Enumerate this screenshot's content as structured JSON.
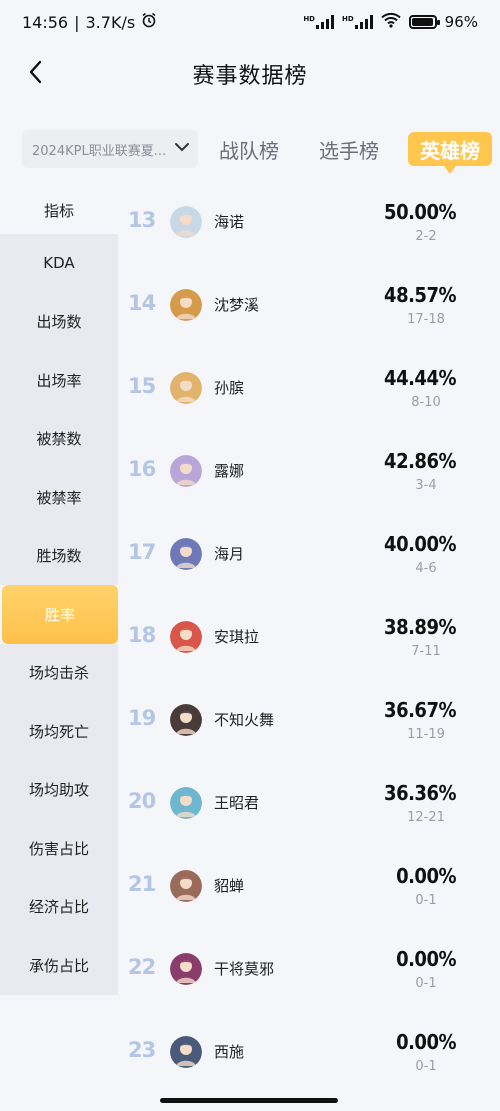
{
  "status_bar": {
    "time": "14:56",
    "speed": "3.7K/s",
    "battery": "96%"
  },
  "header": {
    "title": "赛事数据榜"
  },
  "tabs": {
    "season": "2024KPL职业联赛夏...",
    "team": "战队榜",
    "player": "选手榜",
    "hero": "英雄榜",
    "active": "hero"
  },
  "sidebar": {
    "items": [
      {
        "label": "指标"
      },
      {
        "label": "KDA"
      },
      {
        "label": "出场数"
      },
      {
        "label": "出场率"
      },
      {
        "label": "被禁数"
      },
      {
        "label": "被禁率"
      },
      {
        "label": "胜场数"
      },
      {
        "label": "胜率"
      },
      {
        "label": "场均击杀"
      },
      {
        "label": "场均死亡"
      },
      {
        "label": "场均助攻"
      },
      {
        "label": "伤害占比"
      },
      {
        "label": "经济占比"
      },
      {
        "label": "承伤占比"
      }
    ],
    "active_index": 7
  },
  "heroes": [
    {
      "rank": "13",
      "name": "海诺",
      "rate": "50.00%",
      "record": "2-2",
      "color": "#c9d8e6"
    },
    {
      "rank": "14",
      "name": "沈梦溪",
      "rate": "48.57%",
      "record": "17-18",
      "color": "#d59a4a"
    },
    {
      "rank": "15",
      "name": "孙膑",
      "rate": "44.44%",
      "record": "8-10",
      "color": "#e2b36a"
    },
    {
      "rank": "16",
      "name": "露娜",
      "rate": "42.86%",
      "record": "3-4",
      "color": "#b9a6d9"
    },
    {
      "rank": "17",
      "name": "海月",
      "rate": "40.00%",
      "record": "4-6",
      "color": "#6f79b8"
    },
    {
      "rank": "18",
      "name": "安琪拉",
      "rate": "38.89%",
      "record": "7-11",
      "color": "#d9574a"
    },
    {
      "rank": "19",
      "name": "不知火舞",
      "rate": "36.67%",
      "record": "11-19",
      "color": "#4a3b3b"
    },
    {
      "rank": "20",
      "name": "王昭君",
      "rate": "36.36%",
      "record": "12-21",
      "color": "#6fb7cf"
    },
    {
      "rank": "21",
      "name": "貂蝉",
      "rate": "0.00%",
      "record": "0-1",
      "color": "#9a6a5a"
    },
    {
      "rank": "22",
      "name": "干将莫邪",
      "rate": "0.00%",
      "record": "0-1",
      "color": "#8a3d6a"
    },
    {
      "rank": "23",
      "name": "西施",
      "rate": "0.00%",
      "record": "0-1",
      "color": "#4a5a7a"
    }
  ]
}
